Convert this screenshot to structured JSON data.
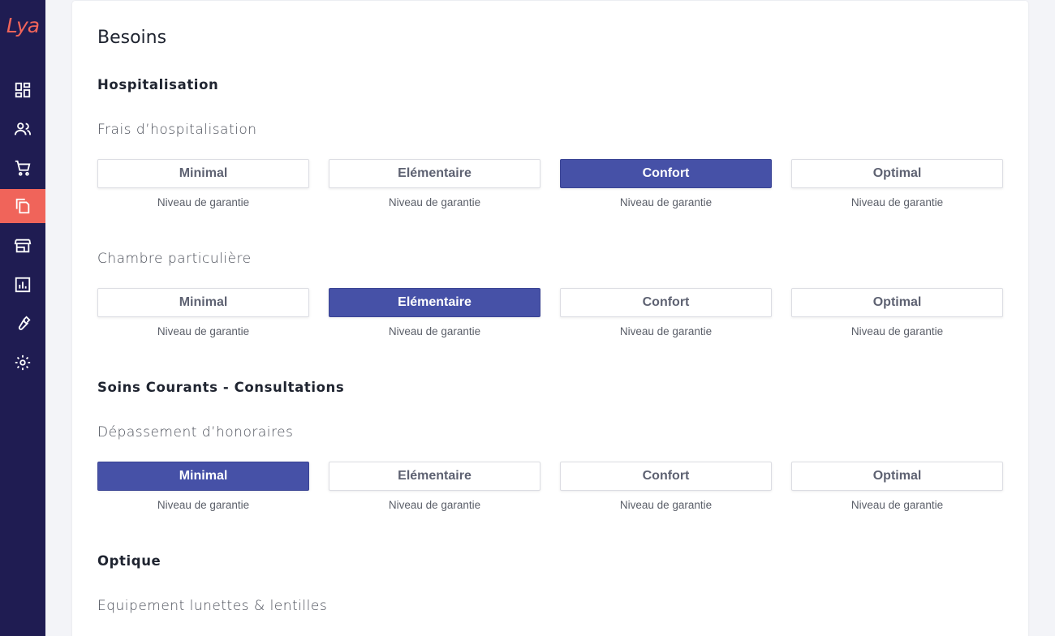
{
  "app": {
    "logo_text": "Lya"
  },
  "sidebar": {
    "items": [
      {
        "icon": "dashboard-icon"
      },
      {
        "icon": "people-icon"
      },
      {
        "icon": "cart-icon"
      },
      {
        "icon": "documents-icon",
        "active": true
      },
      {
        "icon": "store-icon"
      },
      {
        "icon": "chart-icon"
      },
      {
        "icon": "wrench-icon"
      },
      {
        "icon": "gear-icon"
      }
    ]
  },
  "page": {
    "title": "Besoins"
  },
  "sections": [
    {
      "title": "Hospitalisation",
      "groups": [
        {
          "label": "Frais d’hospitalisation",
          "options": [
            "Minimal",
            "Elémentaire",
            "Confort",
            "Optimal"
          ],
          "selected": "Confort",
          "caption": "Niveau de garantie"
        },
        {
          "label": "Chambre particulière",
          "options": [
            "Minimal",
            "Elémentaire",
            "Confort",
            "Optimal"
          ],
          "selected": "Elémentaire",
          "caption": "Niveau de garantie"
        }
      ]
    },
    {
      "title": "Soins Courants - Consultations",
      "groups": [
        {
          "label": "Dépassement d’honoraires",
          "options": [
            "Minimal",
            "Elémentaire",
            "Confort",
            "Optimal"
          ],
          "selected": "Minimal",
          "caption": "Niveau de garantie"
        }
      ]
    },
    {
      "title": "Optique",
      "groups": [
        {
          "label": "Equipement lunettes & lentilles"
        }
      ]
    }
  ],
  "colors": {
    "sidebar_bg": "#1f1c52",
    "accent": "#f0645a",
    "selected": "#4651a7"
  }
}
